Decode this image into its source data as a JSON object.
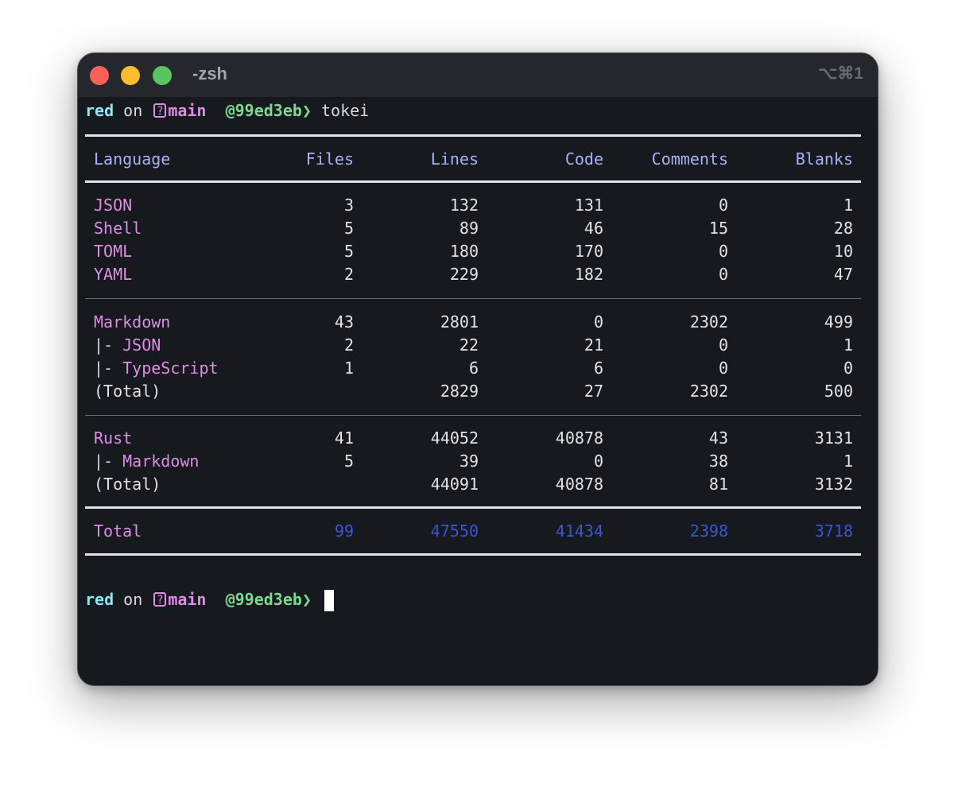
{
  "window": {
    "title": "-zsh",
    "shortcut": "⌥⌘1"
  },
  "prompt": {
    "user": "red",
    "on": "on",
    "branch_icon": "?",
    "branch": "main",
    "hash": "@99ed3eb",
    "arrow": "❯",
    "command": "tokei"
  },
  "table": {
    "headers": [
      "Language",
      "Files",
      "Lines",
      "Code",
      "Comments",
      "Blanks"
    ],
    "group1": [
      {
        "prefix": "",
        "name": "JSON",
        "files": "3",
        "lines": "132",
        "code": "131",
        "comments": "0",
        "blanks": "1"
      },
      {
        "prefix": "",
        "name": "Shell",
        "files": "5",
        "lines": "89",
        "code": "46",
        "comments": "15",
        "blanks": "28"
      },
      {
        "prefix": "",
        "name": "TOML",
        "files": "5",
        "lines": "180",
        "code": "170",
        "comments": "0",
        "blanks": "10"
      },
      {
        "prefix": "",
        "name": "YAML",
        "files": "2",
        "lines": "229",
        "code": "182",
        "comments": "0",
        "blanks": "47"
      }
    ],
    "group2": [
      {
        "prefix": "",
        "name": "Markdown",
        "files": "43",
        "lines": "2801",
        "code": "0",
        "comments": "2302",
        "blanks": "499"
      },
      {
        "prefix": "|- ",
        "name": "JSON",
        "files": "2",
        "lines": "22",
        "code": "21",
        "comments": "0",
        "blanks": "1"
      },
      {
        "prefix": "|- ",
        "name": "TypeScript",
        "files": "1",
        "lines": "6",
        "code": "6",
        "comments": "0",
        "blanks": "0"
      },
      {
        "prefix": "",
        "name": "",
        "total_label": "(Total)",
        "files": "",
        "lines": "2829",
        "code": "27",
        "comments": "2302",
        "blanks": "500"
      }
    ],
    "group3": [
      {
        "prefix": "",
        "name": "Rust",
        "files": "41",
        "lines": "44052",
        "code": "40878",
        "comments": "43",
        "blanks": "3131"
      },
      {
        "prefix": "|- ",
        "name": "Markdown",
        "files": "5",
        "lines": "39",
        "code": "0",
        "comments": "38",
        "blanks": "1"
      },
      {
        "prefix": "",
        "name": "",
        "total_label": "(Total)",
        "files": "",
        "lines": "44091",
        "code": "40878",
        "comments": "81",
        "blanks": "3132"
      }
    ],
    "total": {
      "label": "Total",
      "files": "99",
      "lines": "47550",
      "code": "41434",
      "comments": "2398",
      "blanks": "3718"
    }
  },
  "colors": {
    "background": "#16191e",
    "header": "#a8b2f6",
    "language": "#dd8ee3",
    "total_numbers": "#3a55d6"
  }
}
